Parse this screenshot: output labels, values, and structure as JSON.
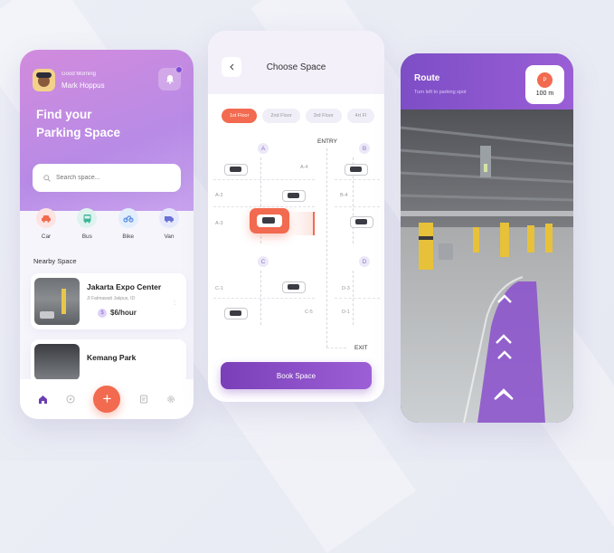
{
  "home": {
    "greeting": "Good Morning",
    "user_name": "Mark Hoppus",
    "hero_line1": "Find your",
    "hero_line2": "Parking Space",
    "search_placeholder": "Search space...",
    "categories": [
      {
        "label": "Car",
        "icon": "car-icon",
        "bg": "#fde3e3",
        "fg": "#f26a4f"
      },
      {
        "label": "Bus",
        "icon": "bus-icon",
        "bg": "#dff3ee",
        "fg": "#3cb59a"
      },
      {
        "label": "Bike",
        "icon": "bike-icon",
        "bg": "#e3eefc",
        "fg": "#5b8fe0"
      },
      {
        "label": "Van",
        "icon": "van-icon",
        "bg": "#e6e8fb",
        "fg": "#6a72d6"
      }
    ],
    "nearby_title": "Nearby Space",
    "places": [
      {
        "name": "Jakarta  Expo Center",
        "address": "Jl Fatmawati Jakpus, ID",
        "price": "$6/hour"
      },
      {
        "name": "Kemang Park"
      }
    ],
    "fab_label": "+"
  },
  "choose": {
    "title": "Choose Space",
    "floors": [
      "1st Floor",
      "2nd Floor",
      "3rd Floor",
      "4rt Fl"
    ],
    "active_floor": "1st Floor",
    "entry_label": "ENTRY",
    "exit_label": "EXIT",
    "sections": [
      "A",
      "B",
      "C",
      "D"
    ],
    "slots": [
      "A-4",
      "A-2",
      "A-3",
      "B-4",
      "C-1",
      "C-5",
      "D-3",
      "D-1"
    ],
    "book_label": "Book Space"
  },
  "route": {
    "title": "Route",
    "subtitle": "Turn left to parking spot",
    "distance": "100 m",
    "distance_icon_text": "P"
  },
  "colors": {
    "accent": "#f26a4f",
    "purple": "#8a4fcc"
  }
}
